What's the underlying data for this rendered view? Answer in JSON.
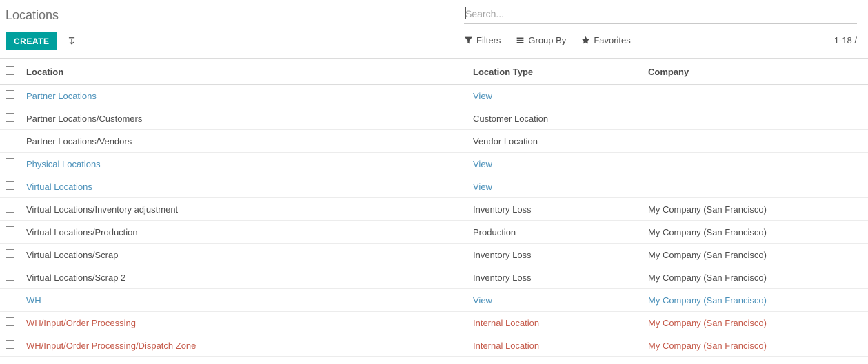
{
  "header": {
    "title": "Locations",
    "create_label": "CREATE"
  },
  "search": {
    "placeholder": "Search..."
  },
  "controls": {
    "filters": "Filters",
    "group_by": "Group By",
    "favorites": "Favorites",
    "pager": "1-18 /"
  },
  "table": {
    "headers": {
      "location": "Location",
      "type": "Location Type",
      "company": "Company"
    },
    "rows": [
      {
        "location": "Partner Locations",
        "type": "View",
        "company": "",
        "loc_style": "c-link",
        "type_style": "c-link",
        "comp_style": "c-text"
      },
      {
        "location": "Partner Locations/Customers",
        "type": "Customer Location",
        "company": "",
        "loc_style": "c-text",
        "type_style": "c-text",
        "comp_style": "c-text"
      },
      {
        "location": "Partner Locations/Vendors",
        "type": "Vendor Location",
        "company": "",
        "loc_style": "c-text",
        "type_style": "c-text",
        "comp_style": "c-text"
      },
      {
        "location": "Physical Locations",
        "type": "View",
        "company": "",
        "loc_style": "c-link",
        "type_style": "c-link",
        "comp_style": "c-text"
      },
      {
        "location": "Virtual Locations",
        "type": "View",
        "company": "",
        "loc_style": "c-link",
        "type_style": "c-link",
        "comp_style": "c-text"
      },
      {
        "location": "Virtual Locations/Inventory adjustment",
        "type": "Inventory Loss",
        "company": "My Company (San Francisco)",
        "loc_style": "c-text",
        "type_style": "c-text",
        "comp_style": "c-text"
      },
      {
        "location": "Virtual Locations/Production",
        "type": "Production",
        "company": "My Company (San Francisco)",
        "loc_style": "c-text",
        "type_style": "c-text",
        "comp_style": "c-text"
      },
      {
        "location": "Virtual Locations/Scrap",
        "type": "Inventory Loss",
        "company": "My Company (San Francisco)",
        "loc_style": "c-text",
        "type_style": "c-text",
        "comp_style": "c-text"
      },
      {
        "location": "Virtual Locations/Scrap 2",
        "type": "Inventory Loss",
        "company": "My Company (San Francisco)",
        "loc_style": "c-text",
        "type_style": "c-text",
        "comp_style": "c-text"
      },
      {
        "location": "WH",
        "type": "View",
        "company": "My Company (San Francisco)",
        "loc_style": "c-link",
        "type_style": "c-link",
        "comp_style": "c-link"
      },
      {
        "location": "WH/Input/Order Processing",
        "type": "Internal Location",
        "company": "My Company (San Francisco)",
        "loc_style": "c-red",
        "type_style": "c-red",
        "comp_style": "c-red"
      },
      {
        "location": "WH/Input/Order Processing/Dispatch Zone",
        "type": "Internal Location",
        "company": "My Company (San Francisco)",
        "loc_style": "c-red",
        "type_style": "c-red",
        "comp_style": "c-red"
      }
    ]
  }
}
